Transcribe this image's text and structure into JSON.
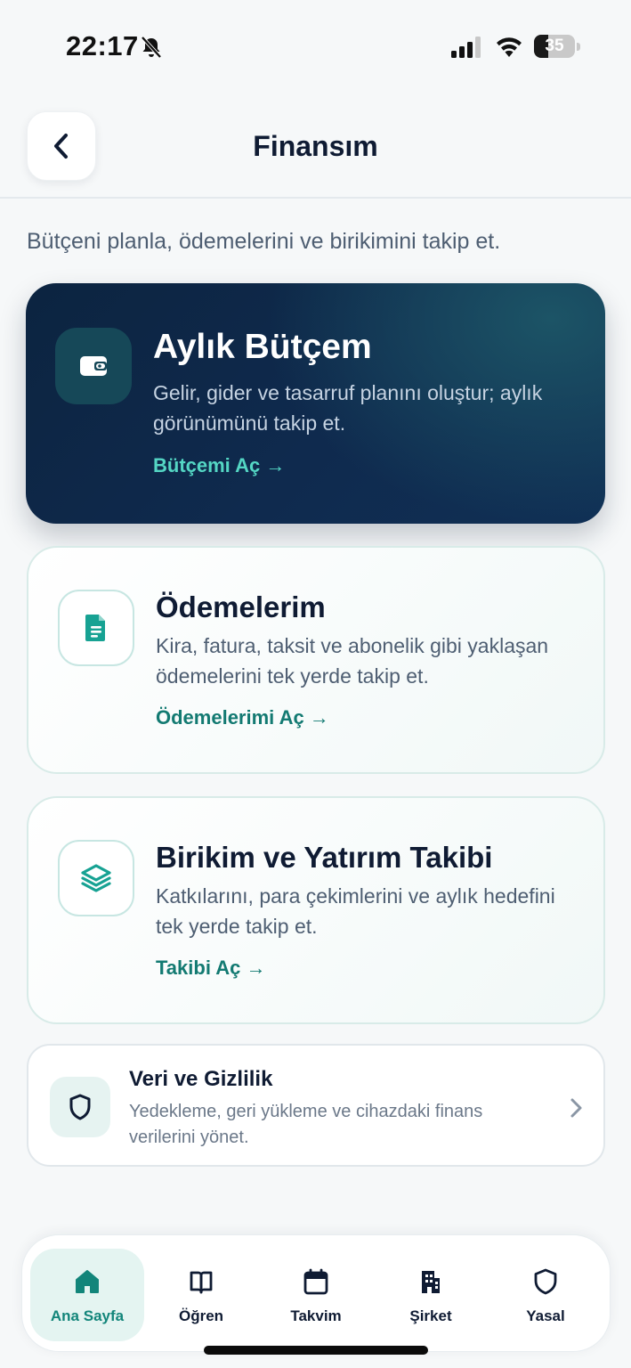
{
  "status_bar": {
    "time": "22:17",
    "battery_percent": 35,
    "battery_label": "35",
    "icons": [
      "bell-slash-icon",
      "signal-icon",
      "wifi-icon",
      "battery-icon"
    ]
  },
  "header": {
    "title": "Finansım",
    "back_icon": "chevron-left-icon"
  },
  "subtitle": "Bütçeni planla, ödemelerini ve birikimini takip et.",
  "hero_card": {
    "icon": "wallet-icon",
    "title": "Aylık Bütçem",
    "description": "Gelir, gider ve tasarruf planını oluştur; aylık görünümünü takip et.",
    "link": "Bütçemi Aç →"
  },
  "feature_cards": [
    {
      "icon": "document-icon",
      "title": "Ödemelerim",
      "description": "Kira, fatura, taksit ve abonelik gibi yaklaşan ödemelerini tek yerde takip et.",
      "link": "Ödemelerimi Aç →"
    },
    {
      "icon": "layers-icon",
      "title": "Birikim ve Yatırım Takibi",
      "description": "Katkılarını, para çekimlerini ve aylık hedefini tek yerde takip et.",
      "link": "Takibi Aç →"
    }
  ],
  "privacy": {
    "icon": "shield-icon",
    "title": "Veri ve Gizlilik",
    "description": "Yedekleme, geri yükleme ve cihazdaki finans verilerini yönet."
  },
  "tab_bar": {
    "active_index": 0,
    "tabs": [
      {
        "label": "Ana Sayfa",
        "icon": "home-icon"
      },
      {
        "label": "Öğren",
        "icon": "book-icon"
      },
      {
        "label": "Takvim",
        "icon": "calendar-icon"
      },
      {
        "label": "Şirket",
        "icon": "building-icon"
      },
      {
        "label": "Yasal",
        "icon": "shield-icon"
      }
    ]
  },
  "colors": {
    "accent": "#12857a",
    "hero_bg": "#0f2a4e",
    "hero_link": "#54d6c4",
    "text_primary": "#0f1b33",
    "text_secondary": "#4e5e72"
  }
}
